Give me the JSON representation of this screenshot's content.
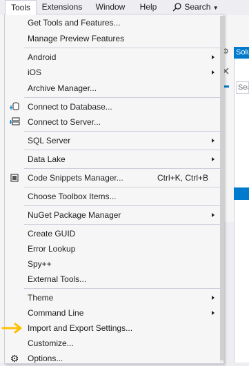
{
  "menubar": {
    "items": [
      "Tools",
      "Extensions",
      "Window",
      "Help"
    ],
    "search_label": "Search",
    "right_fragment": "P"
  },
  "solution_explorer": {
    "header_fragment": "Solu",
    "search_fragment": "Sea"
  },
  "tools_menu": {
    "get_tools": "Get Tools and Features...",
    "manage_preview": "Manage Preview Features",
    "android": "Android",
    "ios": "iOS",
    "archive_manager": "Archive Manager...",
    "connect_db": "Connect to Database...",
    "connect_server": "Connect to Server...",
    "sql_server": "SQL Server",
    "data_lake": "Data Lake",
    "code_snippets": "Code Snippets Manager...",
    "code_snippets_shortcut": "Ctrl+K, Ctrl+B",
    "choose_toolbox": "Choose Toolbox Items...",
    "nuget": "NuGet Package Manager",
    "create_guid": "Create GUID",
    "error_lookup": "Error Lookup",
    "spy": "Spy++",
    "external_tools": "External Tools...",
    "theme": "Theme",
    "command_line": "Command Line",
    "import_export": "Import and Export Settings...",
    "customize": "Customize...",
    "options": "Options..."
  },
  "colors": {
    "accent": "#007acc",
    "annotation_arrow": "#ffc000"
  }
}
